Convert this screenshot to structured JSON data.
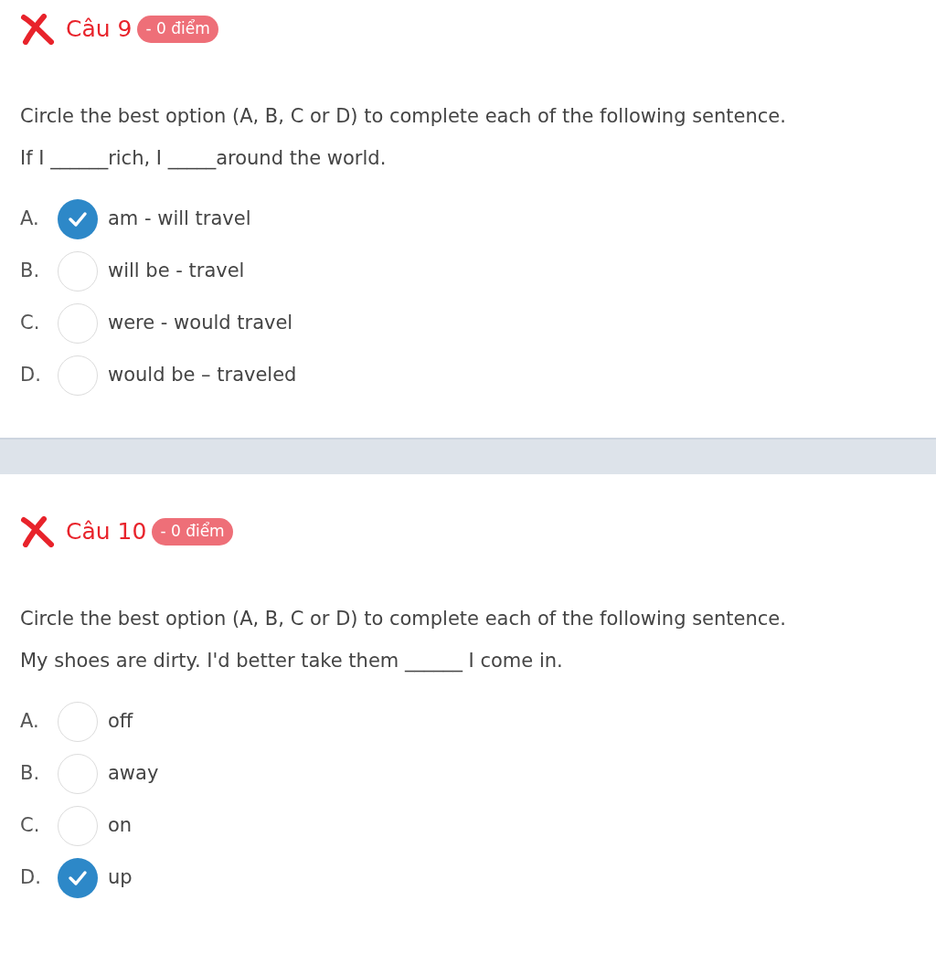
{
  "questions": [
    {
      "title": "Câu 9",
      "badge": "- 0 điểm",
      "correct": false,
      "prompt": "Circle the best option (A, B, C or D) to complete each of the following sentence.",
      "sentence": "If I ______rich, I _____around the world.",
      "options": [
        {
          "letter": "A.",
          "text": "am - will travel",
          "selected": true
        },
        {
          "letter": "B.",
          "text": "will be - travel",
          "selected": false
        },
        {
          "letter": "C.",
          "text": "were - would travel",
          "selected": false
        },
        {
          "letter": "D.",
          "text": "would be – traveled",
          "selected": false
        }
      ]
    },
    {
      "title": "Câu 10",
      "badge": "- 0 điểm",
      "correct": false,
      "prompt": "Circle the best option (A, B, C or D) to complete each of the following sentence.",
      "sentence": "My shoes are dirty. I'd better take them ______ I come in.",
      "options": [
        {
          "letter": "A.",
          "text": "off",
          "selected": false
        },
        {
          "letter": "B.",
          "text": "away",
          "selected": false
        },
        {
          "letter": "C.",
          "text": "on",
          "selected": false
        },
        {
          "letter": "D.",
          "text": "up",
          "selected": true
        }
      ]
    }
  ]
}
